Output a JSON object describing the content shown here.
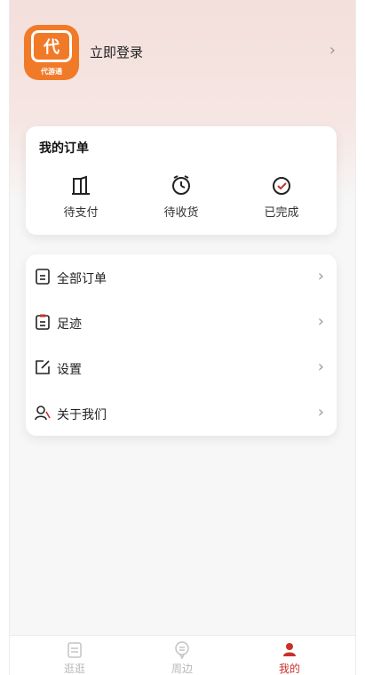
{
  "header": {
    "logo_text": "代游通",
    "logo_glyph": "代",
    "login_label": "立即登录",
    "chevron": "›"
  },
  "orders": {
    "title": "我的订单",
    "items": [
      {
        "label": "待支付",
        "icon": "door-icon"
      },
      {
        "label": "待收货",
        "icon": "alarm-clock-icon"
      },
      {
        "label": "已完成",
        "icon": "check-circle-icon"
      }
    ]
  },
  "menu": {
    "items": [
      {
        "label": "全部订单",
        "icon": "list-icon"
      },
      {
        "label": "足迹",
        "icon": "clipboard-icon"
      },
      {
        "label": "设置",
        "icon": "edit-icon"
      },
      {
        "label": "关于我们",
        "icon": "users-icon"
      }
    ],
    "chevron": "›"
  },
  "tabbar": {
    "tabs": [
      {
        "label": "逛逛",
        "icon": "document-icon",
        "active": false
      },
      {
        "label": "周边",
        "icon": "location-pin-icon",
        "active": false
      },
      {
        "label": "我的",
        "icon": "person-icon",
        "active": true
      }
    ]
  },
  "colors": {
    "accent": "#c9302c",
    "logo_orange": "#f17a28",
    "header_gradient": "#f3dfdb"
  }
}
